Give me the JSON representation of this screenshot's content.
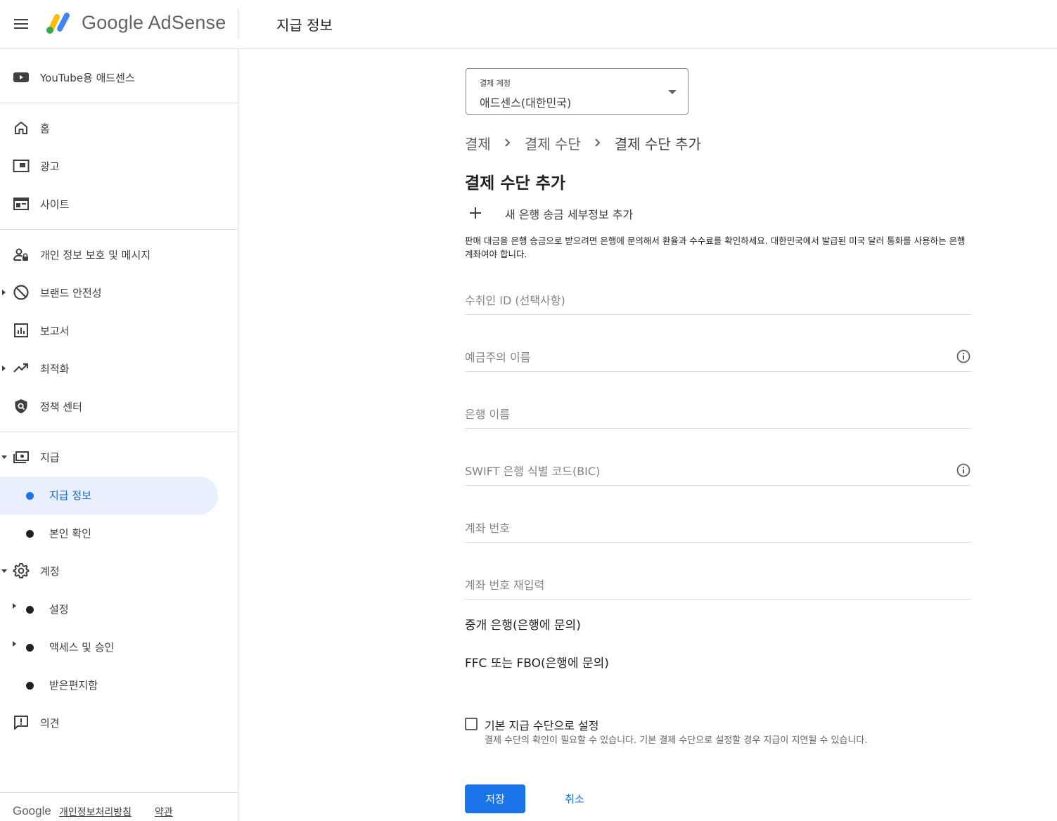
{
  "app": {
    "brand": "Google AdSense",
    "page_title": "지급 정보"
  },
  "sidebar": {
    "youtube": {
      "label": "YouTube용 애드센스",
      "icon": "youtube-icon"
    },
    "items": [
      {
        "label": "홈",
        "icon": "home-icon"
      },
      {
        "label": "광고",
        "icon": "ads-icon"
      },
      {
        "label": "사이트",
        "icon": "sites-icon"
      },
      {
        "label": "개인 정보 보호 및 메시지",
        "icon": "privacy-messaging-icon"
      },
      {
        "label": "브랜드 안전성",
        "icon": "block-icon"
      },
      {
        "label": "보고서",
        "icon": "reports-icon"
      },
      {
        "label": "최적화",
        "icon": "trending-up-icon"
      },
      {
        "label": "정책 센터",
        "icon": "policy-shield-icon"
      },
      {
        "label": "지급",
        "icon": "payments-icon"
      },
      {
        "label": "계정",
        "icon": "settings-gear-icon"
      },
      {
        "label": "의견",
        "icon": "feedback-icon"
      }
    ],
    "payments_sub": [
      {
        "label": "지급 정보",
        "active": true
      },
      {
        "label": "본인 확인",
        "active": false
      }
    ],
    "account_sub": [
      {
        "label": "설정"
      },
      {
        "label": "액세스 및 승인"
      },
      {
        "label": "받은편지함"
      }
    ],
    "footer": {
      "google": "Google",
      "privacy": "개인정보처리방침",
      "terms": "약관"
    }
  },
  "main": {
    "billing_account": {
      "label": "결제 계정",
      "value": "애드센스(대한민국)"
    },
    "breadcrumb": [
      "결제",
      "결제 수단",
      "결제 수단 추가"
    ],
    "title": "결제 수단 추가",
    "add_bank_label": "새 은행 송금 세부정보 추가",
    "notice": "판매 대금을 은행 송금으로 받으려면 은행에 문의해서 환율과 수수료를 확인하세요. 대한민국에서 발급된 미국 달러 통화를 사용하는 은행 계좌여야 합니다.",
    "fields": {
      "payee_id": {
        "placeholder": "수취인 ID (선택사항)",
        "value": ""
      },
      "account_holder": {
        "placeholder": "예금주의 이름",
        "value": ""
      },
      "bank_name": {
        "placeholder": "은행 이름",
        "value": ""
      },
      "swift": {
        "placeholder": "SWIFT 은행 식별 코드(BIC)",
        "value": ""
      },
      "account_number": {
        "placeholder": "계좌 번호",
        "value": ""
      },
      "account_number_confirm": {
        "placeholder": "계좌 번호 재입력",
        "value": ""
      }
    },
    "intermediary_bank": "중개 은행(은행에 문의)",
    "ffc_fbo": "FFC 또는 FBO(은행에 문의)",
    "default_checkbox": {
      "label": "기본 지급 수단으로 설정",
      "help": "결제 수단의 확인이 필요할 수 있습니다. 기본 결제 수단으로 설정할 경우 지급이 지연될 수 있습니다.",
      "checked": false
    },
    "save_label": "저장",
    "cancel_label": "취소"
  },
  "colors": {
    "primary": "#1a73e8",
    "active_bg": "#e8f0fe",
    "logo_yellow": "#fbbc04",
    "logo_green": "#34a853",
    "logo_blue": "#4285f4"
  }
}
